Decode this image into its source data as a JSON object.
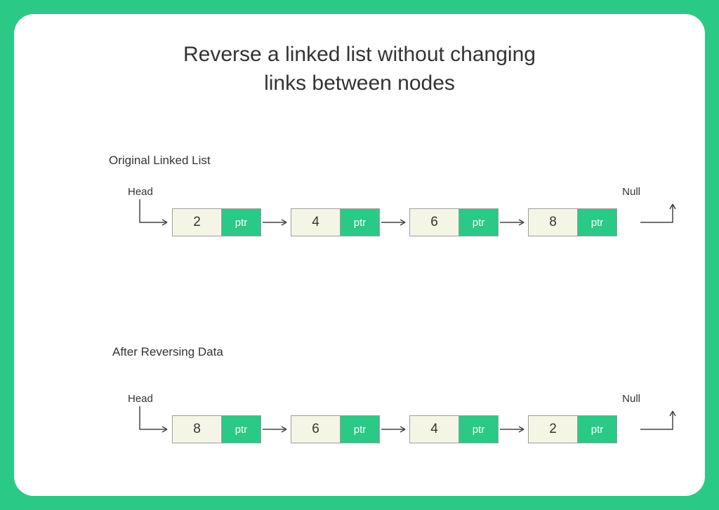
{
  "title_line1": "Reverse a linked list without changing",
  "title_line2": "links between nodes",
  "section1_label": "Original Linked List",
  "section2_label": "After Reversing Data",
  "head_label": "Head",
  "null_label": "Null",
  "ptr_label": "ptr",
  "list1": {
    "n0": "2",
    "n1": "4",
    "n2": "6",
    "n3": "8"
  },
  "list2": {
    "n0": "8",
    "n1": "6",
    "n2": "4",
    "n3": "2"
  },
  "colors": {
    "accent": "#2ac986",
    "node_data_bg": "#f5f5e6"
  }
}
